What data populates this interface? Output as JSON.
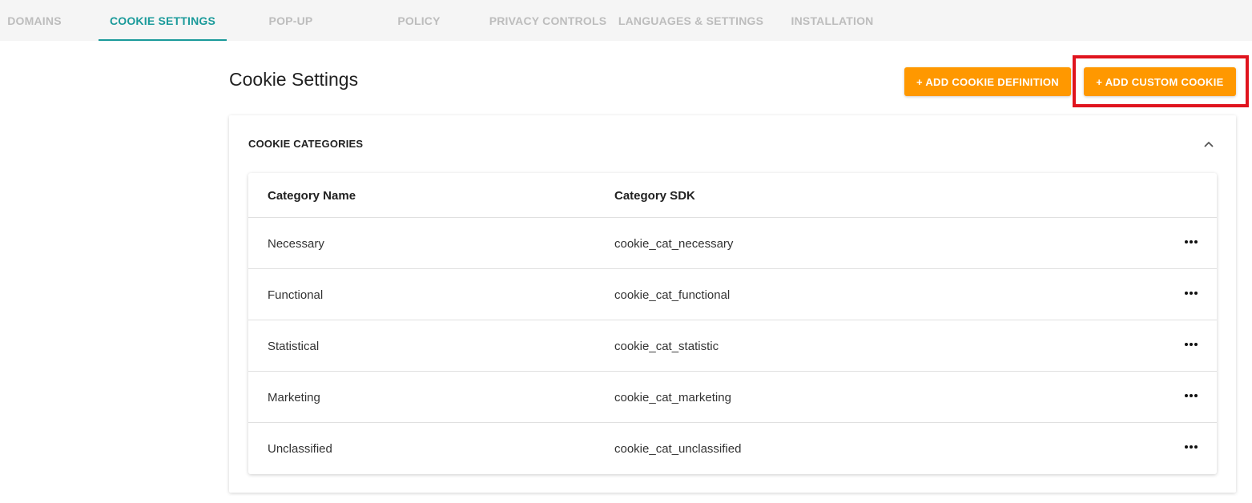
{
  "tabs": [
    {
      "label": "DOMAINS",
      "active": false
    },
    {
      "label": "COOKIE SETTINGS",
      "active": true
    },
    {
      "label": "POP-UP",
      "active": false
    },
    {
      "label": "POLICY",
      "active": false
    },
    {
      "label": "PRIVACY CONTROLS",
      "active": false
    },
    {
      "label": "LANGUAGES & SETTINGS",
      "active": false
    },
    {
      "label": "INSTALLATION",
      "active": false
    }
  ],
  "page": {
    "title": "Cookie Settings",
    "add_definition_label": "+ ADD COOKIE DEFINITION",
    "add_custom_label": "+ ADD CUSTOM COOKIE"
  },
  "categories_panel": {
    "header": "COOKIE CATEGORIES",
    "columns": [
      "Category Name",
      "Category SDK"
    ],
    "rows": [
      {
        "name": "Necessary",
        "sdk": "cookie_cat_necessary"
      },
      {
        "name": "Functional",
        "sdk": "cookie_cat_functional"
      },
      {
        "name": "Statistical",
        "sdk": "cookie_cat_statistic"
      },
      {
        "name": "Marketing",
        "sdk": "cookie_cat_marketing"
      },
      {
        "name": "Unclassified",
        "sdk": "cookie_cat_unclassified"
      }
    ]
  },
  "icons": {
    "collapse": "chevron-up-icon",
    "row_menu": "more-horizontal-icon"
  },
  "colors": {
    "accent": "#1a9a9a",
    "button": "#ff9800",
    "highlight": "#e0141e",
    "inactive_tab": "#bdbdbd"
  }
}
